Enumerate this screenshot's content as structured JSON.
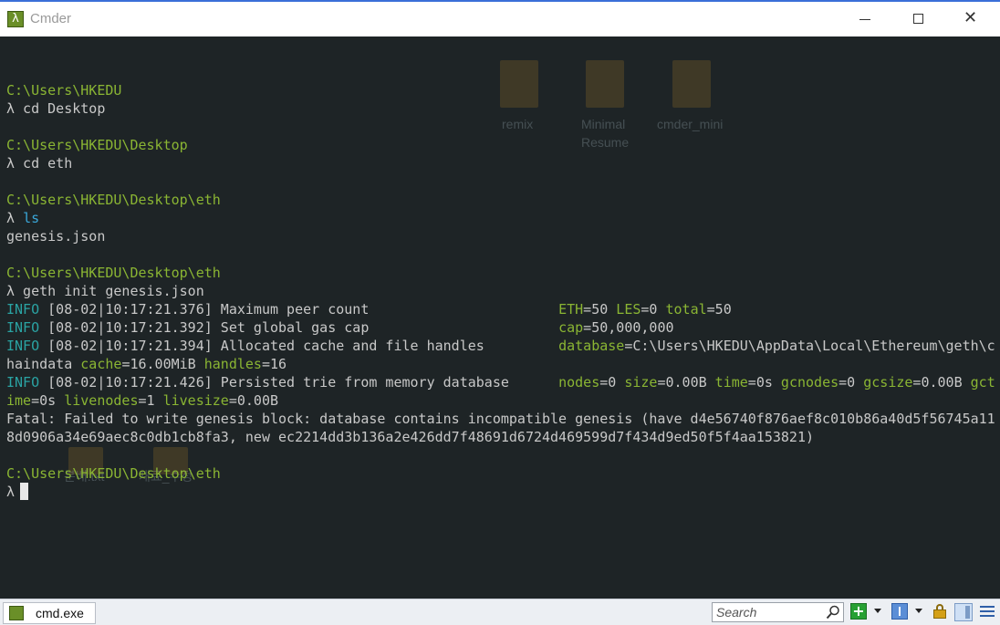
{
  "window": {
    "title": "Cmder",
    "app_icon_glyph": "λ",
    "controls": [
      "minimize",
      "maximize",
      "close"
    ]
  },
  "desktop_ghost_labels": [
    "remix",
    "Minimal",
    "Resume",
    "cmder_mini",
    "분배.txt",
    "재료_수정"
  ],
  "terminal": {
    "lines": [
      {
        "segments": []
      },
      {
        "segments": [
          {
            "cls": "path",
            "text": "C:\\Users\\HKEDU"
          }
        ]
      },
      {
        "segments": [
          {
            "cls": "",
            "text": "λ cd Desktop"
          }
        ]
      },
      {
        "segments": []
      },
      {
        "segments": [
          {
            "cls": "path",
            "text": "C:\\Users\\HKEDU\\Desktop"
          }
        ]
      },
      {
        "segments": [
          {
            "cls": "",
            "text": "λ cd eth"
          }
        ]
      },
      {
        "segments": []
      },
      {
        "segments": [
          {
            "cls": "path",
            "text": "C:\\Users\\HKEDU\\Desktop\\eth"
          }
        ]
      },
      {
        "segments": [
          {
            "cls": "",
            "text": "λ "
          },
          {
            "cls": "cmd-ls",
            "text": "ls"
          }
        ]
      },
      {
        "segments": [
          {
            "cls": "",
            "text": "genesis.json"
          }
        ]
      },
      {
        "segments": []
      },
      {
        "segments": [
          {
            "cls": "path",
            "text": "C:\\Users\\HKEDU\\Desktop\\eth"
          }
        ]
      },
      {
        "segments": [
          {
            "cls": "",
            "text": "λ geth init genesis.json"
          }
        ]
      },
      {
        "segments": [
          {
            "cls": "info",
            "text": "INFO"
          },
          {
            "cls": "",
            "text": " [08-02|10:17:21.376] Maximum peer count                       "
          },
          {
            "cls": "key",
            "text": "ETH"
          },
          {
            "cls": "",
            "text": "=50 "
          },
          {
            "cls": "key",
            "text": "LES"
          },
          {
            "cls": "",
            "text": "=0 "
          },
          {
            "cls": "key",
            "text": "total"
          },
          {
            "cls": "",
            "text": "=50"
          }
        ]
      },
      {
        "segments": [
          {
            "cls": "info",
            "text": "INFO"
          },
          {
            "cls": "",
            "text": " [08-02|10:17:21.392] Set global gas cap                       "
          },
          {
            "cls": "key",
            "text": "cap"
          },
          {
            "cls": "",
            "text": "=50,000,000"
          }
        ]
      },
      {
        "segments": [
          {
            "cls": "info",
            "text": "INFO"
          },
          {
            "cls": "",
            "text": " [08-02|10:17:21.394] Allocated cache and file handles         "
          },
          {
            "cls": "key",
            "text": "database"
          },
          {
            "cls": "",
            "text": "=C:\\Users\\HKEDU\\AppData\\Local\\Ethereum\\geth\\c"
          }
        ]
      },
      {
        "segments": [
          {
            "cls": "",
            "text": "haindata "
          },
          {
            "cls": "key",
            "text": "cache"
          },
          {
            "cls": "",
            "text": "=16.00MiB "
          },
          {
            "cls": "key",
            "text": "handles"
          },
          {
            "cls": "",
            "text": "=16"
          }
        ]
      },
      {
        "segments": [
          {
            "cls": "info",
            "text": "INFO"
          },
          {
            "cls": "",
            "text": " [08-02|10:17:21.426] Persisted trie from memory database      "
          },
          {
            "cls": "key",
            "text": "nodes"
          },
          {
            "cls": "",
            "text": "=0 "
          },
          {
            "cls": "key",
            "text": "size"
          },
          {
            "cls": "",
            "text": "=0.00B "
          },
          {
            "cls": "key",
            "text": "time"
          },
          {
            "cls": "",
            "text": "=0s "
          },
          {
            "cls": "key",
            "text": "gcnodes"
          },
          {
            "cls": "",
            "text": "=0 "
          },
          {
            "cls": "key",
            "text": "gcsize"
          },
          {
            "cls": "",
            "text": "=0.00B "
          },
          {
            "cls": "key",
            "text": "gct"
          }
        ]
      },
      {
        "segments": [
          {
            "cls": "key",
            "text": "ime"
          },
          {
            "cls": "",
            "text": "=0s "
          },
          {
            "cls": "key",
            "text": "livenodes"
          },
          {
            "cls": "",
            "text": "=1 "
          },
          {
            "cls": "key",
            "text": "livesize"
          },
          {
            "cls": "",
            "text": "=0.00B"
          }
        ]
      },
      {
        "segments": [
          {
            "cls": "",
            "text": "Fatal: Failed to write genesis block: database contains incompatible genesis (have d4e56740f876aef8c010b86a40d5f56745a11"
          }
        ]
      },
      {
        "segments": [
          {
            "cls": "",
            "text": "8d0906a34e69aec8c0db1cb8fa3, new ec2214dd3b136a2e426dd7f48691d6724d469599d7f434d9ed50f5f4aa153821)"
          }
        ]
      },
      {
        "segments": []
      },
      {
        "segments": [
          {
            "cls": "path",
            "text": "C:\\Users\\HKEDU\\Desktop\\eth"
          }
        ]
      }
    ],
    "prompt": "λ"
  },
  "statusbar": {
    "tab_label": "cmd.exe",
    "search_placeholder": "Search"
  },
  "colors": {
    "path": "#8ab533",
    "info": "#2aa3a3",
    "text": "#c8c8c8",
    "background": "#1e2426"
  }
}
